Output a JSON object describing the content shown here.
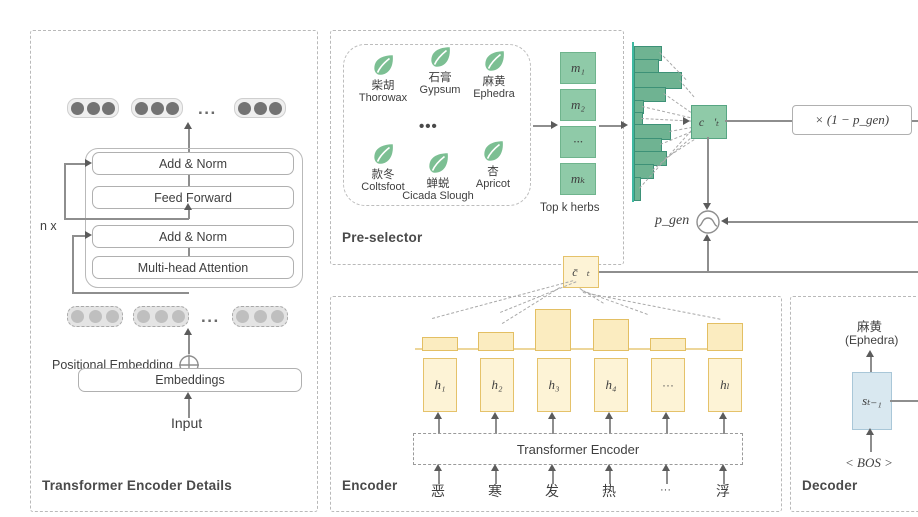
{
  "panels": {
    "transformer": {
      "label": "Transformer Encoder Details"
    },
    "preselector": {
      "label": "Pre-selector"
    },
    "encoder": {
      "label": "Encoder"
    },
    "decoder": {
      "label": "Decoder"
    }
  },
  "transformer": {
    "blocks": [
      "Add & Norm",
      "Feed Forward",
      "Add & Norm",
      "Multi-head Attention"
    ],
    "n_label": "n x",
    "positional_embedding": "Positional Embedding",
    "plus_icon": "circle-plus-icon",
    "embeddings": "Embeddings",
    "input": "Input",
    "ellipsis": "...",
    "output_vectors": [
      {
        "dots": 3
      },
      {
        "dots": 3
      },
      {
        "dots": 3
      }
    ],
    "input_vectors": [
      {
        "dots": 3
      },
      {
        "dots": 3
      },
      {
        "dots": 3
      }
    ]
  },
  "preselector": {
    "herbs": [
      {
        "cn": "柴胡",
        "en": "Thorowax"
      },
      {
        "cn": "石膏",
        "en": "Gypsum"
      },
      {
        "cn": "麻黄",
        "en": "Ephedra"
      },
      {
        "cn": "款冬",
        "en": "Coltsfoot"
      },
      {
        "cn": "蝉蜕",
        "en": "Cicada Slough"
      },
      {
        "cn": "杏",
        "en": "Apricot"
      }
    ],
    "ellipsis": "•••",
    "topk_label": "Top k herbs",
    "m_boxes": [
      "m₁",
      "m₂",
      "···",
      "mₖ"
    ]
  },
  "attention": {
    "herb_dist_label": "herb-distribution-histogram",
    "herb_dist_values": [
      0.52,
      0.45,
      0.92,
      0.6,
      0.16,
      0.13,
      0.7,
      0.52,
      0.62,
      0.37,
      0.1
    ],
    "ct_prime": "c⃗'ₜ",
    "p_gen_label": "p_gen",
    "sigmoid_icon": "sigmoid-gate-icon",
    "one_minus_pgen": "× (1 − p_gen)"
  },
  "encoder": {
    "ct_bar": "c̄⃗ₜ",
    "attention_bars": [
      0.22,
      0.33,
      1.0,
      0.72,
      0.2,
      0.55
    ],
    "hidden_states": [
      "h₁",
      "h₂",
      "h₃",
      "h₄",
      "···",
      "hₗ"
    ],
    "transformer_encoder_label": "Transformer Encoder",
    "tokens": [
      "恶",
      "寒",
      "发",
      "热",
      "···",
      "浮"
    ]
  },
  "decoder": {
    "output_cn": "麻黄",
    "output_en": "(Ephedra)",
    "state": "sₜ₋₁",
    "bos": "< BOS >"
  }
}
